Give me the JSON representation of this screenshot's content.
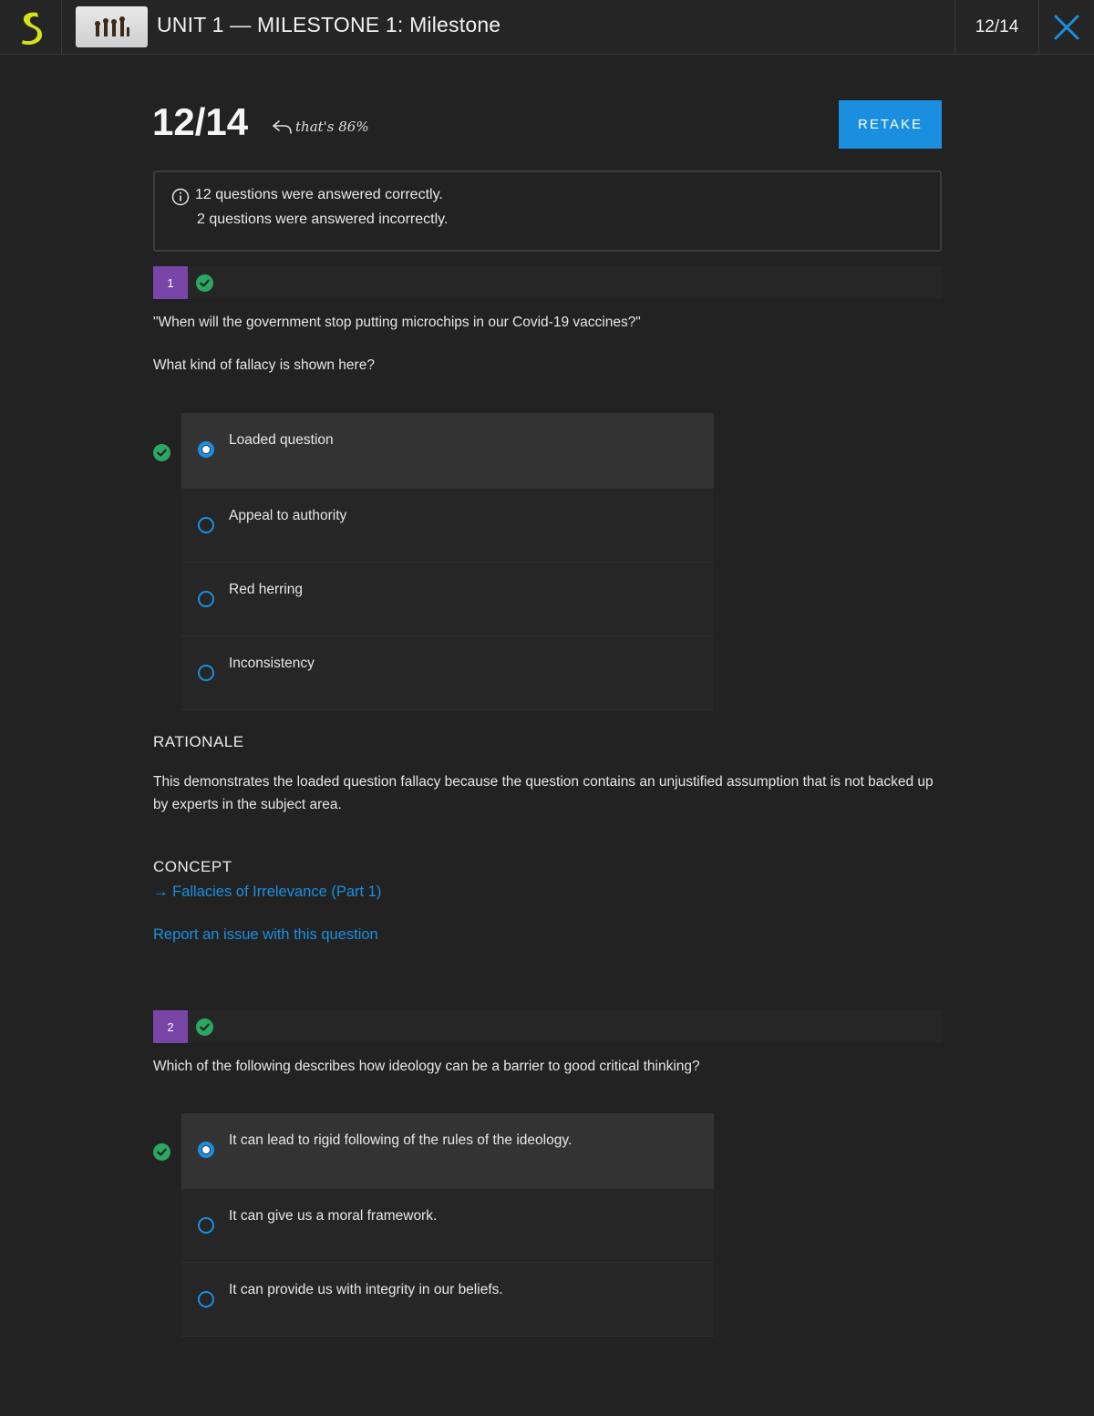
{
  "header": {
    "title": "UNIT 1 — MILESTONE 1: Milestone",
    "progress": "12/14"
  },
  "result": {
    "score": "12/14",
    "note": "that's 86%",
    "retake_label": "RETAKE",
    "summary_correct": "12 questions were answered correctly.",
    "summary_incorrect": "2 questions were answered incorrectly."
  },
  "questions": [
    {
      "number": "1",
      "prompt": "\"When will the government stop putting microchips in our Covid-19 vaccines?\"",
      "question": "What kind of fallacy is shown here?",
      "options": [
        "Loaded question",
        "Appeal to authority",
        "Red herring",
        "Inconsistency"
      ],
      "selected_index": 0,
      "rationale_heading": "RATIONALE",
      "rationale": "This demonstrates the loaded question fallacy because the question contains an unjustified assumption that is not backed up by experts in the subject area.",
      "concept_heading": "CONCEPT",
      "concept_link": "→ Fallacies of Irrelevance (Part 1)",
      "report_link": "Report an issue with this question"
    },
    {
      "number": "2",
      "question": "Which of the following describes how ideology can be a barrier to good critical thinking?",
      "options": [
        "It can lead to rigid following of the rules of the ideology.",
        "It can give us a moral framework.",
        "It can provide us with integrity in our beliefs."
      ],
      "selected_index": 0
    }
  ],
  "colors": {
    "background": "#222222",
    "accent_blue": "#1a8fe0",
    "correct_green": "#2aa760",
    "number_purple": "#7a45a8",
    "logo_yellow": "#d4e21a"
  },
  "icons": [
    "sophia-logo-icon",
    "close-icon",
    "info-icon",
    "reply-arrow-icon",
    "check-circle-icon"
  ]
}
